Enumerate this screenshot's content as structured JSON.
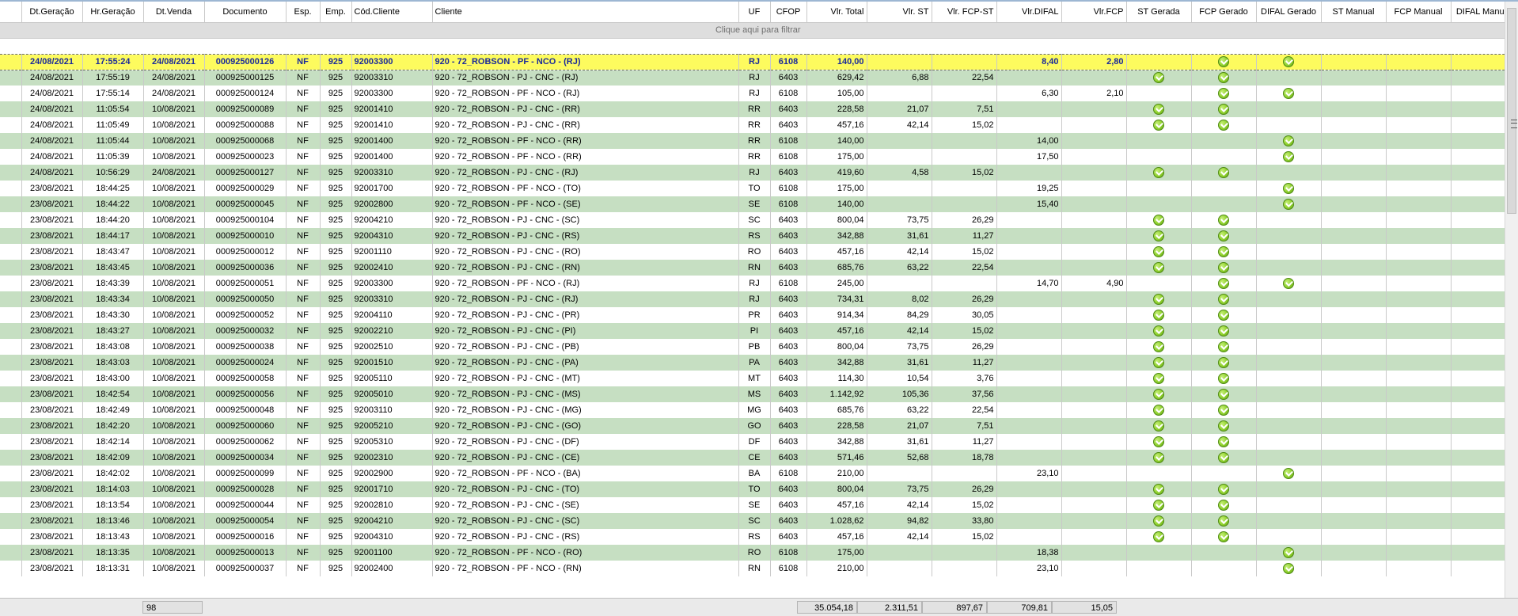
{
  "columns": [
    {
      "key": "dt_geracao",
      "label": "Dt.Geração"
    },
    {
      "key": "hr_geracao",
      "label": "Hr.Geração"
    },
    {
      "key": "dt_venda",
      "label": "Dt.Venda"
    },
    {
      "key": "documento",
      "label": "Documento"
    },
    {
      "key": "esp",
      "label": "Esp."
    },
    {
      "key": "emp",
      "label": "Emp."
    },
    {
      "key": "cod_cliente",
      "label": "Cód.Cliente"
    },
    {
      "key": "cliente",
      "label": "Cliente"
    },
    {
      "key": "uf",
      "label": "UF"
    },
    {
      "key": "cfop",
      "label": "CFOP"
    },
    {
      "key": "vlr_total",
      "label": "Vlr. Total"
    },
    {
      "key": "vlr_st",
      "label": "Vlr. ST"
    },
    {
      "key": "vlr_fcp_st",
      "label": "Vlr. FCP-ST"
    },
    {
      "key": "vlr_difal",
      "label": "Vlr.DIFAL"
    },
    {
      "key": "vlr_fcp",
      "label": "Vlr.FCP"
    },
    {
      "key": "st_gerada",
      "label": "ST Gerada"
    },
    {
      "key": "fcp_gerado",
      "label": "FCP Gerado"
    },
    {
      "key": "difal_gerado",
      "label": "DIFAL Gerado"
    },
    {
      "key": "st_manual",
      "label": "ST Manual"
    },
    {
      "key": "fcp_manual",
      "label": "FCP Manual"
    },
    {
      "key": "difal_manual",
      "label": "DIFAL Manual"
    }
  ],
  "filter_hint": "Clique aqui para filtrar",
  "check_icon": "check-circle-icon",
  "colors": {
    "selected_row": "#fdfb5e",
    "alt_row": "#c6dfc2",
    "selected_text": "#1a2a9a"
  },
  "rows": [
    {
      "dt_geracao": "24/08/2021",
      "hr_geracao": "17:55:24",
      "dt_venda": "24/08/2021",
      "documento": "000925000126",
      "esp": "NF",
      "emp": "925",
      "cod_cliente": "92003300",
      "cliente": "920 - 72_ROBSON - PF - NCO - (RJ)",
      "uf": "RJ",
      "cfop": "6108",
      "vlr_total": "140,00",
      "vlr_st": "",
      "vlr_fcp_st": "",
      "vlr_difal": "8,40",
      "vlr_fcp": "2,80",
      "st_gerada": false,
      "fcp_gerado": true,
      "difal_gerado": true
    },
    {
      "dt_geracao": "24/08/2021",
      "hr_geracao": "17:55:19",
      "dt_venda": "24/08/2021",
      "documento": "000925000125",
      "esp": "NF",
      "emp": "925",
      "cod_cliente": "92003310",
      "cliente": "920 - 72_ROBSON - PJ - CNC - (RJ)",
      "uf": "RJ",
      "cfop": "6403",
      "vlr_total": "629,42",
      "vlr_st": "6,88",
      "vlr_fcp_st": "22,54",
      "vlr_difal": "",
      "vlr_fcp": "",
      "st_gerada": true,
      "fcp_gerado": true,
      "difal_gerado": false
    },
    {
      "dt_geracao": "24/08/2021",
      "hr_geracao": "17:55:14",
      "dt_venda": "24/08/2021",
      "documento": "000925000124",
      "esp": "NF",
      "emp": "925",
      "cod_cliente": "92003300",
      "cliente": "920 - 72_ROBSON - PF - NCO - (RJ)",
      "uf": "RJ",
      "cfop": "6108",
      "vlr_total": "105,00",
      "vlr_st": "",
      "vlr_fcp_st": "",
      "vlr_difal": "6,30",
      "vlr_fcp": "2,10",
      "st_gerada": false,
      "fcp_gerado": true,
      "difal_gerado": true
    },
    {
      "dt_geracao": "24/08/2021",
      "hr_geracao": "11:05:54",
      "dt_venda": "10/08/2021",
      "documento": "000925000089",
      "esp": "NF",
      "emp": "925",
      "cod_cliente": "92001410",
      "cliente": "920 - 72_ROBSON - PJ - CNC - (RR)",
      "uf": "RR",
      "cfop": "6403",
      "vlr_total": "228,58",
      "vlr_st": "21,07",
      "vlr_fcp_st": "7,51",
      "vlr_difal": "",
      "vlr_fcp": "",
      "st_gerada": true,
      "fcp_gerado": true,
      "difal_gerado": false
    },
    {
      "dt_geracao": "24/08/2021",
      "hr_geracao": "11:05:49",
      "dt_venda": "10/08/2021",
      "documento": "000925000088",
      "esp": "NF",
      "emp": "925",
      "cod_cliente": "92001410",
      "cliente": "920 - 72_ROBSON - PJ - CNC - (RR)",
      "uf": "RR",
      "cfop": "6403",
      "vlr_total": "457,16",
      "vlr_st": "42,14",
      "vlr_fcp_st": "15,02",
      "vlr_difal": "",
      "vlr_fcp": "",
      "st_gerada": true,
      "fcp_gerado": true,
      "difal_gerado": false
    },
    {
      "dt_geracao": "24/08/2021",
      "hr_geracao": "11:05:44",
      "dt_venda": "10/08/2021",
      "documento": "000925000068",
      "esp": "NF",
      "emp": "925",
      "cod_cliente": "92001400",
      "cliente": "920 - 72_ROBSON - PF - NCO - (RR)",
      "uf": "RR",
      "cfop": "6108",
      "vlr_total": "140,00",
      "vlr_st": "",
      "vlr_fcp_st": "",
      "vlr_difal": "14,00",
      "vlr_fcp": "",
      "st_gerada": false,
      "fcp_gerado": false,
      "difal_gerado": true
    },
    {
      "dt_geracao": "24/08/2021",
      "hr_geracao": "11:05:39",
      "dt_venda": "10/08/2021",
      "documento": "000925000023",
      "esp": "NF",
      "emp": "925",
      "cod_cliente": "92001400",
      "cliente": "920 - 72_ROBSON - PF - NCO - (RR)",
      "uf": "RR",
      "cfop": "6108",
      "vlr_total": "175,00",
      "vlr_st": "",
      "vlr_fcp_st": "",
      "vlr_difal": "17,50",
      "vlr_fcp": "",
      "st_gerada": false,
      "fcp_gerado": false,
      "difal_gerado": true
    },
    {
      "dt_geracao": "24/08/2021",
      "hr_geracao": "10:56:29",
      "dt_venda": "24/08/2021",
      "documento": "000925000127",
      "esp": "NF",
      "emp": "925",
      "cod_cliente": "92003310",
      "cliente": "920 - 72_ROBSON - PJ - CNC - (RJ)",
      "uf": "RJ",
      "cfop": "6403",
      "vlr_total": "419,60",
      "vlr_st": "4,58",
      "vlr_fcp_st": "15,02",
      "vlr_difal": "",
      "vlr_fcp": "",
      "st_gerada": true,
      "fcp_gerado": true,
      "difal_gerado": false
    },
    {
      "dt_geracao": "23/08/2021",
      "hr_geracao": "18:44:25",
      "dt_venda": "10/08/2021",
      "documento": "000925000029",
      "esp": "NF",
      "emp": "925",
      "cod_cliente": "92001700",
      "cliente": "920 - 72_ROBSON - PF - NCO - (TO)",
      "uf": "TO",
      "cfop": "6108",
      "vlr_total": "175,00",
      "vlr_st": "",
      "vlr_fcp_st": "",
      "vlr_difal": "19,25",
      "vlr_fcp": "",
      "st_gerada": false,
      "fcp_gerado": false,
      "difal_gerado": true
    },
    {
      "dt_geracao": "23/08/2021",
      "hr_geracao": "18:44:22",
      "dt_venda": "10/08/2021",
      "documento": "000925000045",
      "esp": "NF",
      "emp": "925",
      "cod_cliente": "92002800",
      "cliente": "920 - 72_ROBSON - PF - NCO - (SE)",
      "uf": "SE",
      "cfop": "6108",
      "vlr_total": "140,00",
      "vlr_st": "",
      "vlr_fcp_st": "",
      "vlr_difal": "15,40",
      "vlr_fcp": "",
      "st_gerada": false,
      "fcp_gerado": false,
      "difal_gerado": true
    },
    {
      "dt_geracao": "23/08/2021",
      "hr_geracao": "18:44:20",
      "dt_venda": "10/08/2021",
      "documento": "000925000104",
      "esp": "NF",
      "emp": "925",
      "cod_cliente": "92004210",
      "cliente": "920 - 72_ROBSON - PJ - CNC - (SC)",
      "uf": "SC",
      "cfop": "6403",
      "vlr_total": "800,04",
      "vlr_st": "73,75",
      "vlr_fcp_st": "26,29",
      "vlr_difal": "",
      "vlr_fcp": "",
      "st_gerada": true,
      "fcp_gerado": true,
      "difal_gerado": false
    },
    {
      "dt_geracao": "23/08/2021",
      "hr_geracao": "18:44:17",
      "dt_venda": "10/08/2021",
      "documento": "000925000010",
      "esp": "NF",
      "emp": "925",
      "cod_cliente": "92004310",
      "cliente": "920 - 72_ROBSON - PJ - CNC - (RS)",
      "uf": "RS",
      "cfop": "6403",
      "vlr_total": "342,88",
      "vlr_st": "31,61",
      "vlr_fcp_st": "11,27",
      "vlr_difal": "",
      "vlr_fcp": "",
      "st_gerada": true,
      "fcp_gerado": true,
      "difal_gerado": false
    },
    {
      "dt_geracao": "23/08/2021",
      "hr_geracao": "18:43:47",
      "dt_venda": "10/08/2021",
      "documento": "000925000012",
      "esp": "NF",
      "emp": "925",
      "cod_cliente": "92001110",
      "cliente": "920 - 72_ROBSON - PJ - CNC - (RO)",
      "uf": "RO",
      "cfop": "6403",
      "vlr_total": "457,16",
      "vlr_st": "42,14",
      "vlr_fcp_st": "15,02",
      "vlr_difal": "",
      "vlr_fcp": "",
      "st_gerada": true,
      "fcp_gerado": true,
      "difal_gerado": false
    },
    {
      "dt_geracao": "23/08/2021",
      "hr_geracao": "18:43:45",
      "dt_venda": "10/08/2021",
      "documento": "000925000036",
      "esp": "NF",
      "emp": "925",
      "cod_cliente": "92002410",
      "cliente": "920 - 72_ROBSON - PJ - CNC - (RN)",
      "uf": "RN",
      "cfop": "6403",
      "vlr_total": "685,76",
      "vlr_st": "63,22",
      "vlr_fcp_st": "22,54",
      "vlr_difal": "",
      "vlr_fcp": "",
      "st_gerada": true,
      "fcp_gerado": true,
      "difal_gerado": false
    },
    {
      "dt_geracao": "23/08/2021",
      "hr_geracao": "18:43:39",
      "dt_venda": "10/08/2021",
      "documento": "000925000051",
      "esp": "NF",
      "emp": "925",
      "cod_cliente": "92003300",
      "cliente": "920 - 72_ROBSON - PF - NCO - (RJ)",
      "uf": "RJ",
      "cfop": "6108",
      "vlr_total": "245,00",
      "vlr_st": "",
      "vlr_fcp_st": "",
      "vlr_difal": "14,70",
      "vlr_fcp": "4,90",
      "st_gerada": false,
      "fcp_gerado": true,
      "difal_gerado": true
    },
    {
      "dt_geracao": "23/08/2021",
      "hr_geracao": "18:43:34",
      "dt_venda": "10/08/2021",
      "documento": "000925000050",
      "esp": "NF",
      "emp": "925",
      "cod_cliente": "92003310",
      "cliente": "920 - 72_ROBSON - PJ - CNC - (RJ)",
      "uf": "RJ",
      "cfop": "6403",
      "vlr_total": "734,31",
      "vlr_st": "8,02",
      "vlr_fcp_st": "26,29",
      "vlr_difal": "",
      "vlr_fcp": "",
      "st_gerada": true,
      "fcp_gerado": true,
      "difal_gerado": false
    },
    {
      "dt_geracao": "23/08/2021",
      "hr_geracao": "18:43:30",
      "dt_venda": "10/08/2021",
      "documento": "000925000052",
      "esp": "NF",
      "emp": "925",
      "cod_cliente": "92004110",
      "cliente": "920 - 72_ROBSON - PJ - CNC - (PR)",
      "uf": "PR",
      "cfop": "6403",
      "vlr_total": "914,34",
      "vlr_st": "84,29",
      "vlr_fcp_st": "30,05",
      "vlr_difal": "",
      "vlr_fcp": "",
      "st_gerada": true,
      "fcp_gerado": true,
      "difal_gerado": false
    },
    {
      "dt_geracao": "23/08/2021",
      "hr_geracao": "18:43:27",
      "dt_venda": "10/08/2021",
      "documento": "000925000032",
      "esp": "NF",
      "emp": "925",
      "cod_cliente": "92002210",
      "cliente": "920 - 72_ROBSON - PJ - CNC - (PI)",
      "uf": "PI",
      "cfop": "6403",
      "vlr_total": "457,16",
      "vlr_st": "42,14",
      "vlr_fcp_st": "15,02",
      "vlr_difal": "",
      "vlr_fcp": "",
      "st_gerada": true,
      "fcp_gerado": true,
      "difal_gerado": false
    },
    {
      "dt_geracao": "23/08/2021",
      "hr_geracao": "18:43:08",
      "dt_venda": "10/08/2021",
      "documento": "000925000038",
      "esp": "NF",
      "emp": "925",
      "cod_cliente": "92002510",
      "cliente": "920 - 72_ROBSON - PJ - CNC - (PB)",
      "uf": "PB",
      "cfop": "6403",
      "vlr_total": "800,04",
      "vlr_st": "73,75",
      "vlr_fcp_st": "26,29",
      "vlr_difal": "",
      "vlr_fcp": "",
      "st_gerada": true,
      "fcp_gerado": true,
      "difal_gerado": false
    },
    {
      "dt_geracao": "23/08/2021",
      "hr_geracao": "18:43:03",
      "dt_venda": "10/08/2021",
      "documento": "000925000024",
      "esp": "NF",
      "emp": "925",
      "cod_cliente": "92001510",
      "cliente": "920 - 72_ROBSON - PJ - CNC - (PA)",
      "uf": "PA",
      "cfop": "6403",
      "vlr_total": "342,88",
      "vlr_st": "31,61",
      "vlr_fcp_st": "11,27",
      "vlr_difal": "",
      "vlr_fcp": "",
      "st_gerada": true,
      "fcp_gerado": true,
      "difal_gerado": false
    },
    {
      "dt_geracao": "23/08/2021",
      "hr_geracao": "18:43:00",
      "dt_venda": "10/08/2021",
      "documento": "000925000058",
      "esp": "NF",
      "emp": "925",
      "cod_cliente": "92005110",
      "cliente": "920 - 72_ROBSON - PJ - CNC - (MT)",
      "uf": "MT",
      "cfop": "6403",
      "vlr_total": "114,30",
      "vlr_st": "10,54",
      "vlr_fcp_st": "3,76",
      "vlr_difal": "",
      "vlr_fcp": "",
      "st_gerada": true,
      "fcp_gerado": true,
      "difal_gerado": false
    },
    {
      "dt_geracao": "23/08/2021",
      "hr_geracao": "18:42:54",
      "dt_venda": "10/08/2021",
      "documento": "000925000056",
      "esp": "NF",
      "emp": "925",
      "cod_cliente": "92005010",
      "cliente": "920 - 72_ROBSON - PJ - CNC - (MS)",
      "uf": "MS",
      "cfop": "6403",
      "vlr_total": "1.142,92",
      "vlr_st": "105,36",
      "vlr_fcp_st": "37,56",
      "vlr_difal": "",
      "vlr_fcp": "",
      "st_gerada": true,
      "fcp_gerado": true,
      "difal_gerado": false
    },
    {
      "dt_geracao": "23/08/2021",
      "hr_geracao": "18:42:49",
      "dt_venda": "10/08/2021",
      "documento": "000925000048",
      "esp": "NF",
      "emp": "925",
      "cod_cliente": "92003110",
      "cliente": "920 - 72_ROBSON - PJ - CNC - (MG)",
      "uf": "MG",
      "cfop": "6403",
      "vlr_total": "685,76",
      "vlr_st": "63,22",
      "vlr_fcp_st": "22,54",
      "vlr_difal": "",
      "vlr_fcp": "",
      "st_gerada": true,
      "fcp_gerado": true,
      "difal_gerado": false
    },
    {
      "dt_geracao": "23/08/2021",
      "hr_geracao": "18:42:20",
      "dt_venda": "10/08/2021",
      "documento": "000925000060",
      "esp": "NF",
      "emp": "925",
      "cod_cliente": "92005210",
      "cliente": "920 - 72_ROBSON - PJ - CNC - (GO)",
      "uf": "GO",
      "cfop": "6403",
      "vlr_total": "228,58",
      "vlr_st": "21,07",
      "vlr_fcp_st": "7,51",
      "vlr_difal": "",
      "vlr_fcp": "",
      "st_gerada": true,
      "fcp_gerado": true,
      "difal_gerado": false
    },
    {
      "dt_geracao": "23/08/2021",
      "hr_geracao": "18:42:14",
      "dt_venda": "10/08/2021",
      "documento": "000925000062",
      "esp": "NF",
      "emp": "925",
      "cod_cliente": "92005310",
      "cliente": "920 - 72_ROBSON - PJ - CNC - (DF)",
      "uf": "DF",
      "cfop": "6403",
      "vlr_total": "342,88",
      "vlr_st": "31,61",
      "vlr_fcp_st": "11,27",
      "vlr_difal": "",
      "vlr_fcp": "",
      "st_gerada": true,
      "fcp_gerado": true,
      "difal_gerado": false
    },
    {
      "dt_geracao": "23/08/2021",
      "hr_geracao": "18:42:09",
      "dt_venda": "10/08/2021",
      "documento": "000925000034",
      "esp": "NF",
      "emp": "925",
      "cod_cliente": "92002310",
      "cliente": "920 - 72_ROBSON - PJ - CNC - (CE)",
      "uf": "CE",
      "cfop": "6403",
      "vlr_total": "571,46",
      "vlr_st": "52,68",
      "vlr_fcp_st": "18,78",
      "vlr_difal": "",
      "vlr_fcp": "",
      "st_gerada": true,
      "fcp_gerado": true,
      "difal_gerado": false
    },
    {
      "dt_geracao": "23/08/2021",
      "hr_geracao": "18:42:02",
      "dt_venda": "10/08/2021",
      "documento": "000925000099",
      "esp": "NF",
      "emp": "925",
      "cod_cliente": "92002900",
      "cliente": "920 - 72_ROBSON - PF - NCO - (BA)",
      "uf": "BA",
      "cfop": "6108",
      "vlr_total": "210,00",
      "vlr_st": "",
      "vlr_fcp_st": "",
      "vlr_difal": "23,10",
      "vlr_fcp": "",
      "st_gerada": false,
      "fcp_gerado": false,
      "difal_gerado": true
    },
    {
      "dt_geracao": "23/08/2021",
      "hr_geracao": "18:14:03",
      "dt_venda": "10/08/2021",
      "documento": "000925000028",
      "esp": "NF",
      "emp": "925",
      "cod_cliente": "92001710",
      "cliente": "920 - 72_ROBSON - PJ - CNC - (TO)",
      "uf": "TO",
      "cfop": "6403",
      "vlr_total": "800,04",
      "vlr_st": "73,75",
      "vlr_fcp_st": "26,29",
      "vlr_difal": "",
      "vlr_fcp": "",
      "st_gerada": true,
      "fcp_gerado": true,
      "difal_gerado": false
    },
    {
      "dt_geracao": "23/08/2021",
      "hr_geracao": "18:13:54",
      "dt_venda": "10/08/2021",
      "documento": "000925000044",
      "esp": "NF",
      "emp": "925",
      "cod_cliente": "92002810",
      "cliente": "920 - 72_ROBSON - PJ - CNC - (SE)",
      "uf": "SE",
      "cfop": "6403",
      "vlr_total": "457,16",
      "vlr_st": "42,14",
      "vlr_fcp_st": "15,02",
      "vlr_difal": "",
      "vlr_fcp": "",
      "st_gerada": true,
      "fcp_gerado": true,
      "difal_gerado": false
    },
    {
      "dt_geracao": "23/08/2021",
      "hr_geracao": "18:13:46",
      "dt_venda": "10/08/2021",
      "documento": "000925000054",
      "esp": "NF",
      "emp": "925",
      "cod_cliente": "92004210",
      "cliente": "920 - 72_ROBSON - PJ - CNC - (SC)",
      "uf": "SC",
      "cfop": "6403",
      "vlr_total": "1.028,62",
      "vlr_st": "94,82",
      "vlr_fcp_st": "33,80",
      "vlr_difal": "",
      "vlr_fcp": "",
      "st_gerada": true,
      "fcp_gerado": true,
      "difal_gerado": false
    },
    {
      "dt_geracao": "23/08/2021",
      "hr_geracao": "18:13:43",
      "dt_venda": "10/08/2021",
      "documento": "000925000016",
      "esp": "NF",
      "emp": "925",
      "cod_cliente": "92004310",
      "cliente": "920 - 72_ROBSON - PJ - CNC - (RS)",
      "uf": "RS",
      "cfop": "6403",
      "vlr_total": "457,16",
      "vlr_st": "42,14",
      "vlr_fcp_st": "15,02",
      "vlr_difal": "",
      "vlr_fcp": "",
      "st_gerada": true,
      "fcp_gerado": true,
      "difal_gerado": false
    },
    {
      "dt_geracao": "23/08/2021",
      "hr_geracao": "18:13:35",
      "dt_venda": "10/08/2021",
      "documento": "000925000013",
      "esp": "NF",
      "emp": "925",
      "cod_cliente": "92001100",
      "cliente": "920 - 72_ROBSON - PF - NCO - (RO)",
      "uf": "RO",
      "cfop": "6108",
      "vlr_total": "175,00",
      "vlr_st": "",
      "vlr_fcp_st": "",
      "vlr_difal": "18,38",
      "vlr_fcp": "",
      "st_gerada": false,
      "fcp_gerado": false,
      "difal_gerado": true
    },
    {
      "dt_geracao": "23/08/2021",
      "hr_geracao": "18:13:31",
      "dt_venda": "10/08/2021",
      "documento": "000925000037",
      "esp": "NF",
      "emp": "925",
      "cod_cliente": "92002400",
      "cliente": "920 - 72_ROBSON - PF - NCO - (RN)",
      "uf": "RN",
      "cfop": "6108",
      "vlr_total": "210,00",
      "vlr_st": "",
      "vlr_fcp_st": "",
      "vlr_difal": "23,10",
      "vlr_fcp": "",
      "st_gerada": false,
      "fcp_gerado": false,
      "difal_gerado": true
    }
  ],
  "footer": {
    "record_count": "98",
    "total_vlr_total": "35.054,18",
    "total_vlr_st": "2.311,51",
    "total_vlr_fcp_st": "897,67",
    "total_vlr_difal": "709,81",
    "total_vlr_fcp": "15,05"
  }
}
